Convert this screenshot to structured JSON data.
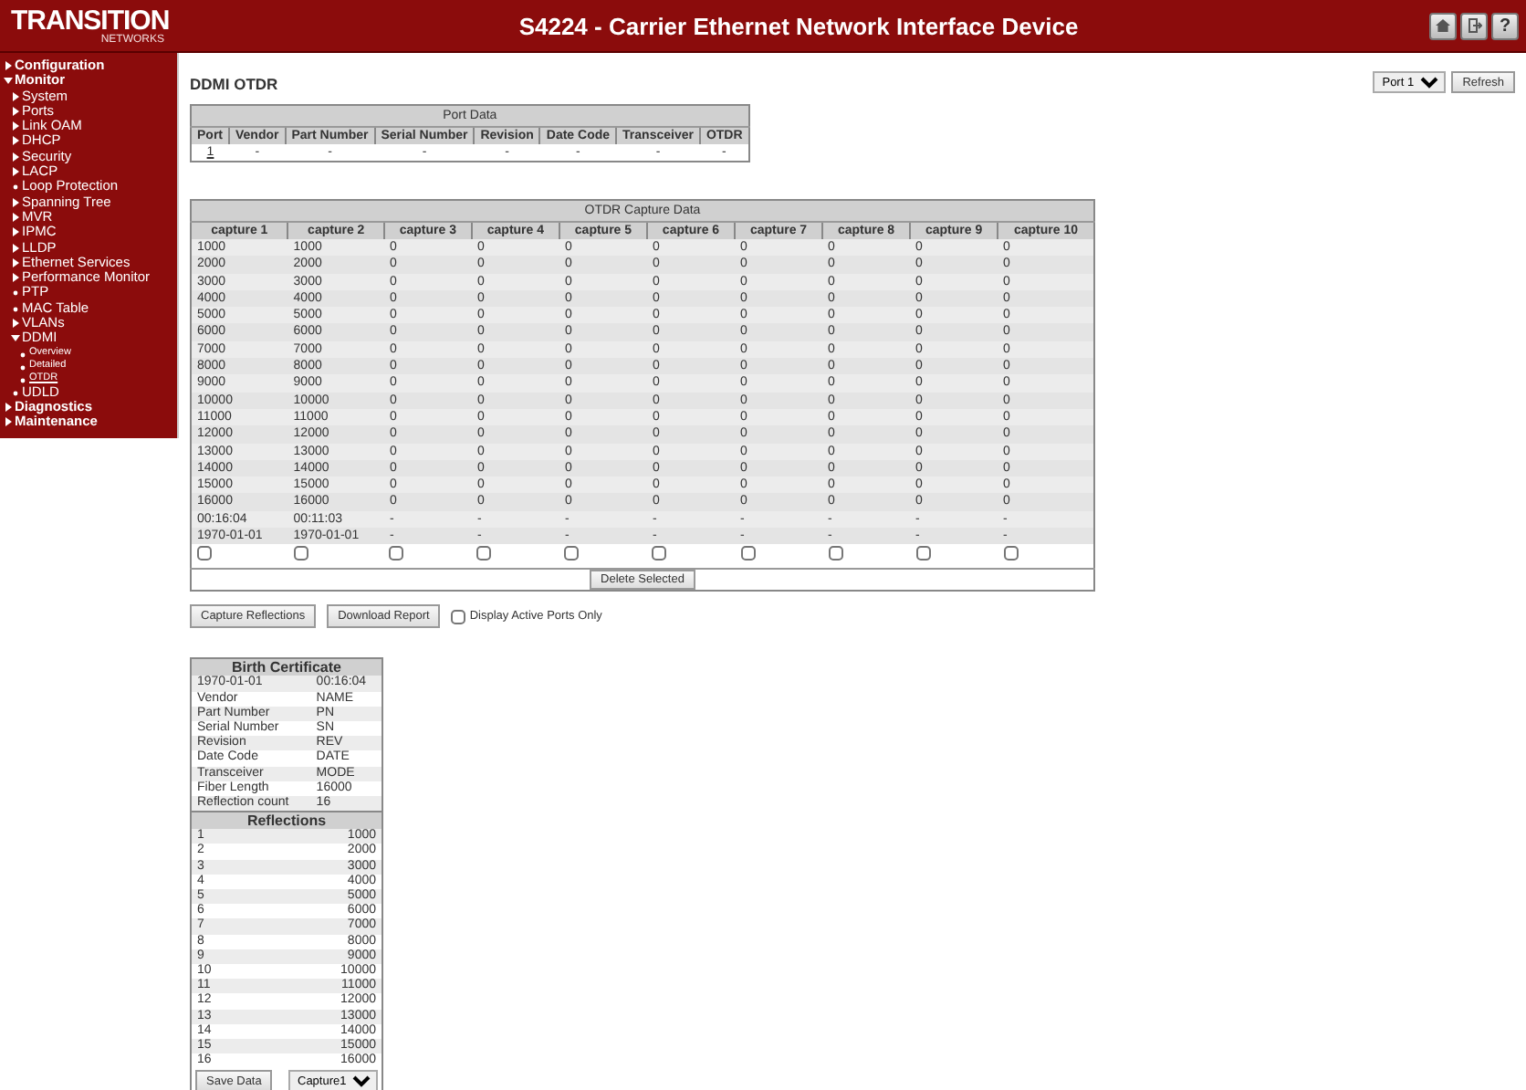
{
  "header": {
    "logo": {
      "name": "TRANSITION",
      "sub": "NETWORKS"
    },
    "title": "S4224 - Carrier Ethernet Network Interface Device",
    "icons": [
      {
        "kind": "home"
      },
      {
        "kind": "logout"
      },
      {
        "kind": "help",
        "label": "?"
      }
    ]
  },
  "sidebar": {
    "items": [
      {
        "label": "Configuration",
        "kind": "branch",
        "expanded": false
      },
      {
        "label": "Monitor",
        "kind": "branch",
        "expanded": true,
        "children": [
          {
            "label": "System",
            "kind": "branch",
            "expanded": false
          },
          {
            "label": "Ports",
            "kind": "branch",
            "expanded": false
          },
          {
            "label": "Link OAM",
            "kind": "branch",
            "expanded": false
          },
          {
            "label": "DHCP",
            "kind": "branch",
            "expanded": false
          },
          {
            "label": "Security",
            "kind": "branch",
            "expanded": false
          },
          {
            "label": "LACP",
            "kind": "branch",
            "expanded": false
          },
          {
            "label": "Loop Protection",
            "kind": "leaf",
            "selected": false
          },
          {
            "label": "Spanning Tree",
            "kind": "branch",
            "expanded": false
          },
          {
            "label": "MVR",
            "kind": "branch",
            "expanded": false
          },
          {
            "label": "IPMC",
            "kind": "branch",
            "expanded": false
          },
          {
            "label": "LLDP",
            "kind": "branch",
            "expanded": false
          },
          {
            "label": "Ethernet Services",
            "kind": "branch",
            "expanded": false
          },
          {
            "label": "Performance Monitor",
            "kind": "branch",
            "expanded": false
          },
          {
            "label": "PTP",
            "kind": "leaf",
            "selected": false
          },
          {
            "label": "MAC Table",
            "kind": "leaf",
            "selected": false
          },
          {
            "label": "VLANs",
            "kind": "branch",
            "expanded": false
          },
          {
            "label": "DDMI",
            "kind": "branch",
            "expanded": true,
            "children": [
              {
                "label": "Overview",
                "kind": "leaf",
                "selected": false
              },
              {
                "label": "Detailed",
                "kind": "leaf",
                "selected": false
              },
              {
                "label": "OTDR",
                "kind": "leaf",
                "selected": true
              }
            ]
          },
          {
            "label": "UDLD",
            "kind": "leaf",
            "selected": false
          }
        ]
      },
      {
        "label": "Diagnostics",
        "kind": "branch",
        "expanded": false
      },
      {
        "label": "Maintenance",
        "kind": "branch",
        "expanded": false
      }
    ]
  },
  "page_title": "DDMI OTDR",
  "port_select": {
    "value": "Port 1"
  },
  "refresh_button": "Refresh",
  "port_data": {
    "title": "Port Data",
    "columns": [
      "Port",
      "Vendor",
      "Part Number",
      "Serial Number",
      "Revision",
      "Date Code",
      "Transceiver",
      "OTDR"
    ],
    "row": [
      "1",
      "-",
      "-",
      "-",
      "-",
      "-",
      "-",
      "-"
    ]
  },
  "otdr": {
    "title": "OTDR Capture Data",
    "columns": [
      "capture 1",
      "capture 2",
      "capture 3",
      "capture 4",
      "capture 5",
      "capture 6",
      "capture 7",
      "capture 8",
      "capture 9",
      "capture 10"
    ],
    "rows": [
      [
        "1000",
        "1000",
        "0",
        "0",
        "0",
        "0",
        "0",
        "0",
        "0",
        "0"
      ],
      [
        "2000",
        "2000",
        "0",
        "0",
        "0",
        "0",
        "0",
        "0",
        "0",
        "0"
      ],
      [
        "3000",
        "3000",
        "0",
        "0",
        "0",
        "0",
        "0",
        "0",
        "0",
        "0"
      ],
      [
        "4000",
        "4000",
        "0",
        "0",
        "0",
        "0",
        "0",
        "0",
        "0",
        "0"
      ],
      [
        "5000",
        "5000",
        "0",
        "0",
        "0",
        "0",
        "0",
        "0",
        "0",
        "0"
      ],
      [
        "6000",
        "6000",
        "0",
        "0",
        "0",
        "0",
        "0",
        "0",
        "0",
        "0"
      ],
      [
        "7000",
        "7000",
        "0",
        "0",
        "0",
        "0",
        "0",
        "0",
        "0",
        "0"
      ],
      [
        "8000",
        "8000",
        "0",
        "0",
        "0",
        "0",
        "0",
        "0",
        "0",
        "0"
      ],
      [
        "9000",
        "9000",
        "0",
        "0",
        "0",
        "0",
        "0",
        "0",
        "0",
        "0"
      ],
      [
        "10000",
        "10000",
        "0",
        "0",
        "0",
        "0",
        "0",
        "0",
        "0",
        "0"
      ],
      [
        "11000",
        "11000",
        "0",
        "0",
        "0",
        "0",
        "0",
        "0",
        "0",
        "0"
      ],
      [
        "12000",
        "12000",
        "0",
        "0",
        "0",
        "0",
        "0",
        "0",
        "0",
        "0"
      ],
      [
        "13000",
        "13000",
        "0",
        "0",
        "0",
        "0",
        "0",
        "0",
        "0",
        "0"
      ],
      [
        "14000",
        "14000",
        "0",
        "0",
        "0",
        "0",
        "0",
        "0",
        "0",
        "0"
      ],
      [
        "15000",
        "15000",
        "0",
        "0",
        "0",
        "0",
        "0",
        "0",
        "0",
        "0"
      ],
      [
        "16000",
        "16000",
        "0",
        "0",
        "0",
        "0",
        "0",
        "0",
        "0",
        "0"
      ],
      [
        "00:16:04",
        "00:11:03",
        "-",
        "-",
        "-",
        "-",
        "-",
        "-",
        "-",
        "-"
      ],
      [
        "1970-01-01",
        "1970-01-01",
        "-",
        "-",
        "-",
        "-",
        "-",
        "-",
        "-",
        "-"
      ]
    ],
    "checks": [
      {
        "checked": false
      },
      {
        "checked": false
      },
      {
        "checked": false
      },
      {
        "checked": false
      },
      {
        "checked": false
      },
      {
        "checked": false
      },
      {
        "checked": false
      },
      {
        "checked": false
      },
      {
        "checked": false
      },
      {
        "checked": false
      }
    ],
    "delete_button": "Delete Selected"
  },
  "actions": {
    "capture_button": "Capture Reflections",
    "download_button": "Download Report",
    "active_only": {
      "label": "Display Active Ports Only",
      "checked": false
    }
  },
  "birth_certificate": {
    "title": "Birth Certificate",
    "rows": [
      [
        "1970-01-01",
        "00:16:04"
      ],
      [
        "Vendor",
        "NAME"
      ],
      [
        "Part Number",
        "PN"
      ],
      [
        "Serial Number",
        "SN"
      ],
      [
        "Revision",
        "REV"
      ],
      [
        "Date Code",
        "DATE"
      ],
      [
        "Transceiver",
        "MODE"
      ],
      [
        "Fiber Length",
        "16000"
      ],
      [
        "Reflection count",
        "16"
      ]
    ]
  },
  "reflections": {
    "title": "Reflections",
    "rows": [
      [
        "1",
        "1000"
      ],
      [
        "2",
        "2000"
      ],
      [
        "3",
        "3000"
      ],
      [
        "4",
        "4000"
      ],
      [
        "5",
        "5000"
      ],
      [
        "6",
        "6000"
      ],
      [
        "7",
        "7000"
      ],
      [
        "8",
        "8000"
      ],
      [
        "9",
        "9000"
      ],
      [
        "10",
        "10000"
      ],
      [
        "11",
        "11000"
      ],
      [
        "12",
        "12000"
      ],
      [
        "13",
        "13000"
      ],
      [
        "14",
        "14000"
      ],
      [
        "15",
        "15000"
      ],
      [
        "16",
        "16000"
      ]
    ],
    "save_button": "Save Data",
    "capture_select": {
      "value": "Capture1"
    }
  }
}
